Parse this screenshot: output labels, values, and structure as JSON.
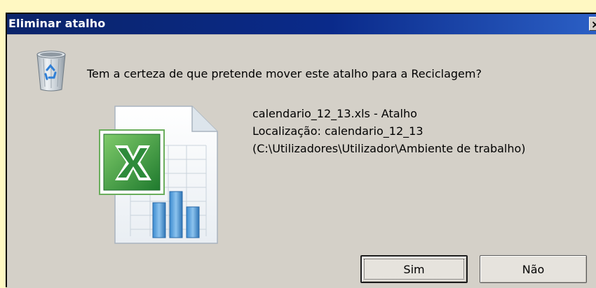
{
  "dialog": {
    "title": "Eliminar atalho",
    "close_label": "×",
    "question": "Tem a certeza de que pretende mover este atalho para a Reciclagem?",
    "file": {
      "name": "calendario_12_13.xls - Atalho",
      "location": "Localização: calendario_12_13",
      "path": "(C:\\Utilizadores\\Utilizador\\Ambiente de trabalho)"
    },
    "buttons": {
      "yes_label": "Sim",
      "no_label": "Não"
    }
  },
  "icons": {
    "recycle": "recycle-bin-icon",
    "file": "excel-file-icon"
  },
  "colors": {
    "titlebar": "#0A2A8A",
    "dialog_bg": "#D4D0C8",
    "page_bg": "#FFF8C2"
  }
}
